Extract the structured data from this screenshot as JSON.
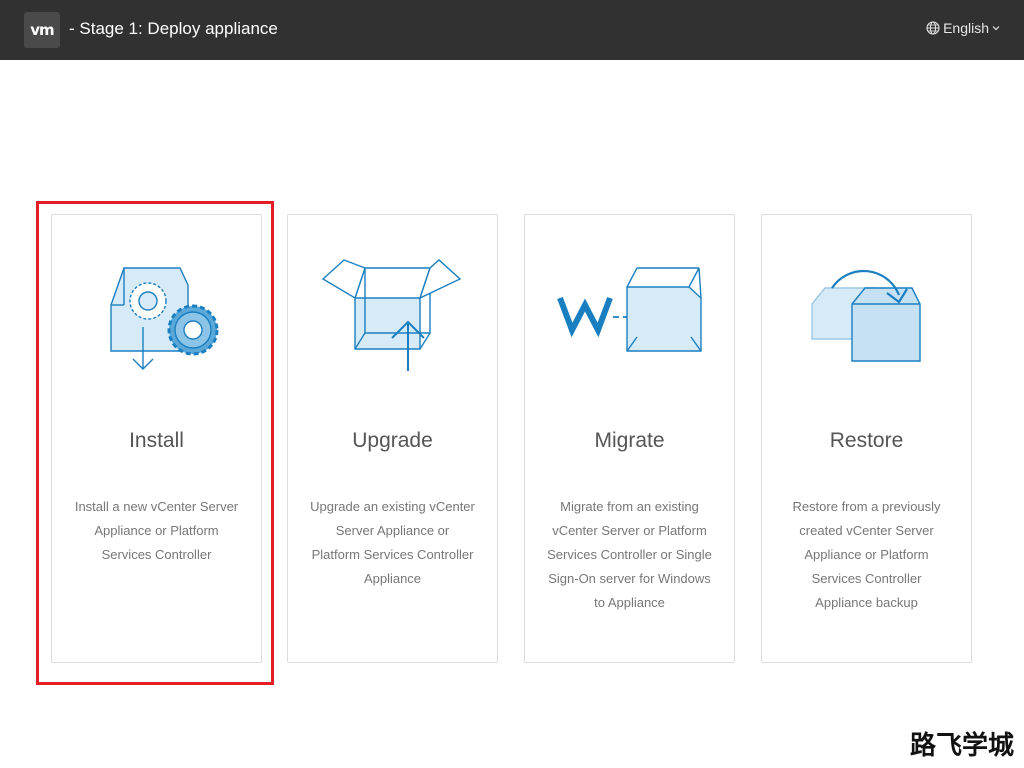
{
  "header": {
    "logo_text": "vm",
    "title": "- Stage 1: Deploy appliance",
    "language": "English"
  },
  "cards": [
    {
      "title": "Install",
      "description": "Install a new vCenter Server Appliance or Platform Services Controller",
      "icon": "install-icon"
    },
    {
      "title": "Upgrade",
      "description": "Upgrade an existing vCenter Server Appliance or Platform Services Controller Appliance",
      "icon": "upgrade-icon"
    },
    {
      "title": "Migrate",
      "description": "Migrate from an existing vCenter Server or Platform Services Controller or Single Sign-On server for Windows to Appliance",
      "icon": "migrate-icon"
    },
    {
      "title": "Restore",
      "description": "Restore from a previously created vCenter Server Appliance or Platform Services Controller Appliance backup",
      "icon": "restore-icon"
    }
  ],
  "highlighted_card": "Install",
  "watermark": "路飞学城",
  "colors": {
    "header_bg": "#313131",
    "icon_blue": "#1a7fc1",
    "icon_fill": "#d6eaf8",
    "highlight": "#e31e24"
  }
}
